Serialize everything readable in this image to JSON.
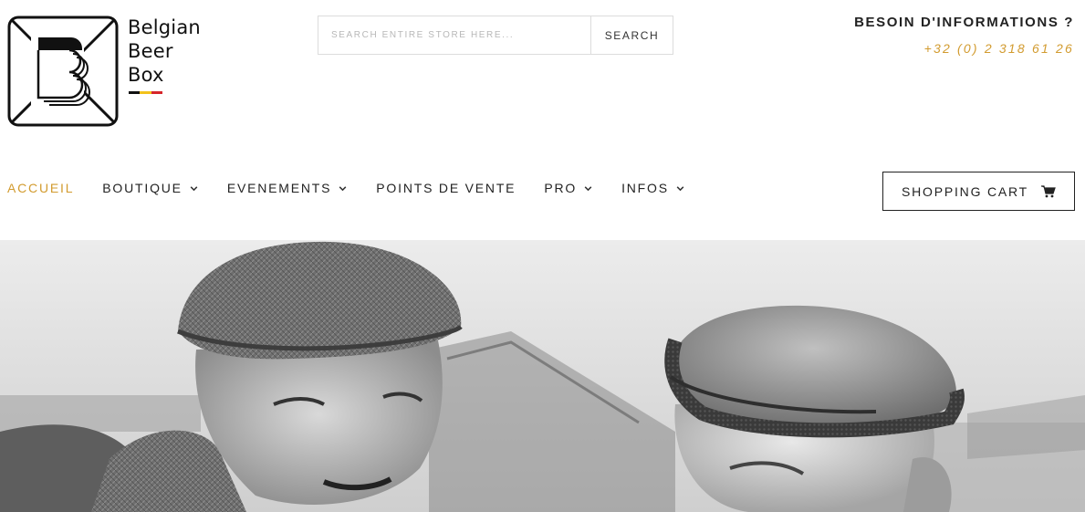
{
  "brand": {
    "name_lines": [
      "Belgian",
      "Beer",
      "Box"
    ],
    "flag_colors": [
      "#111111",
      "#f2c21b",
      "#d6262b"
    ]
  },
  "search": {
    "placeholder": "SEARCH ENTIRE STORE HERE...",
    "button_label": "SEARCH"
  },
  "info": {
    "title": "BESOIN D'INFORMATIONS ?",
    "phone": "+32 (0) 2 318 61 26"
  },
  "nav": {
    "items": [
      {
        "label": "ACCUEIL",
        "active": true,
        "has_dropdown": false
      },
      {
        "label": "BOUTIQUE",
        "active": false,
        "has_dropdown": true
      },
      {
        "label": "EVENEMENTS",
        "active": false,
        "has_dropdown": true
      },
      {
        "label": "POINTS DE VENTE",
        "active": false,
        "has_dropdown": false
      },
      {
        "label": "PRO",
        "active": false,
        "has_dropdown": true
      },
      {
        "label": "INFOS",
        "active": false,
        "has_dropdown": true
      }
    ]
  },
  "cart": {
    "label": "SHOPPING CART",
    "icon": "cart-icon"
  },
  "colors": {
    "accent": "#d29b2f",
    "text": "#222222"
  }
}
